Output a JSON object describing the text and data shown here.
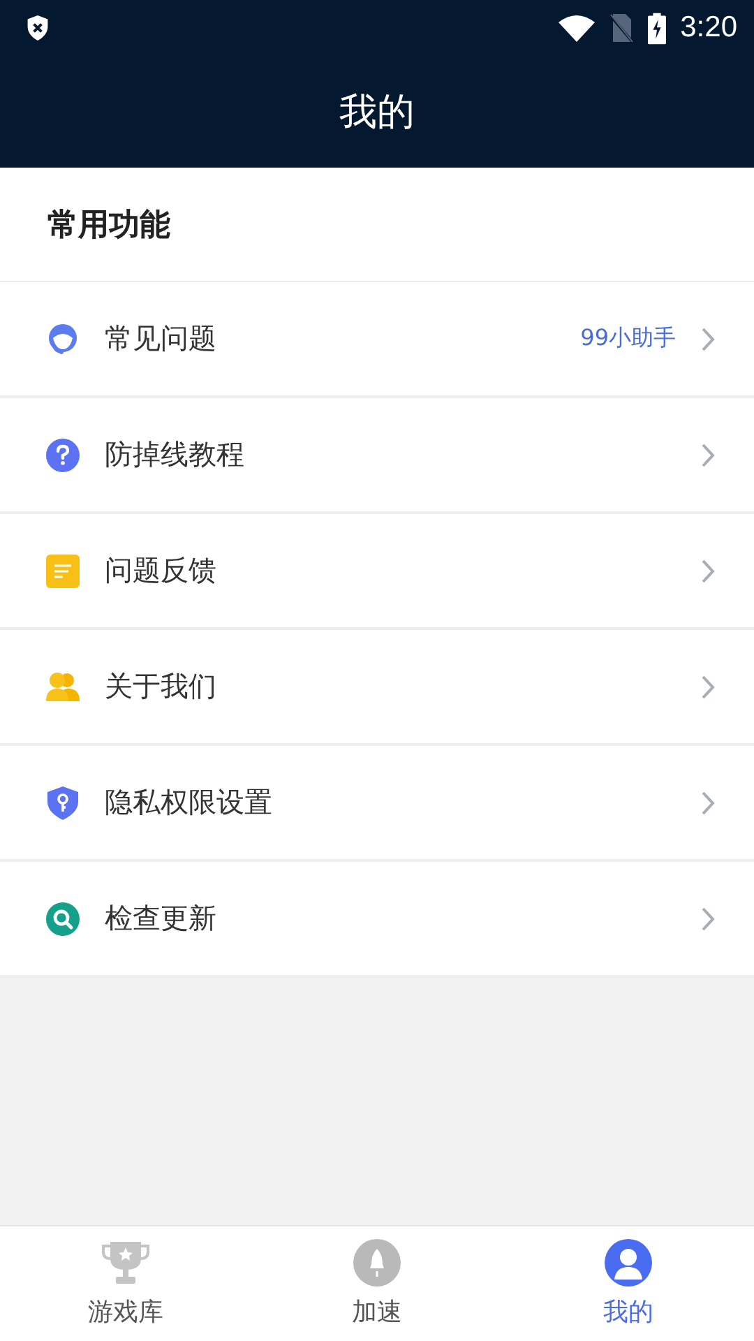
{
  "status_bar": {
    "time": "3:20"
  },
  "header": {
    "title": "我的"
  },
  "section": {
    "title": "常用功能"
  },
  "menu_items": [
    {
      "label": "常见问题",
      "note": "99小助手"
    },
    {
      "label": "防掉线教程"
    },
    {
      "label": "问题反馈"
    },
    {
      "label": "关于我们"
    },
    {
      "label": "隐私权限设置"
    },
    {
      "label": "检查更新"
    }
  ],
  "bottom_tabs": [
    {
      "label": "游戏库",
      "selected": false
    },
    {
      "label": "加速",
      "selected": false
    },
    {
      "label": "我的",
      "selected": true
    }
  ]
}
